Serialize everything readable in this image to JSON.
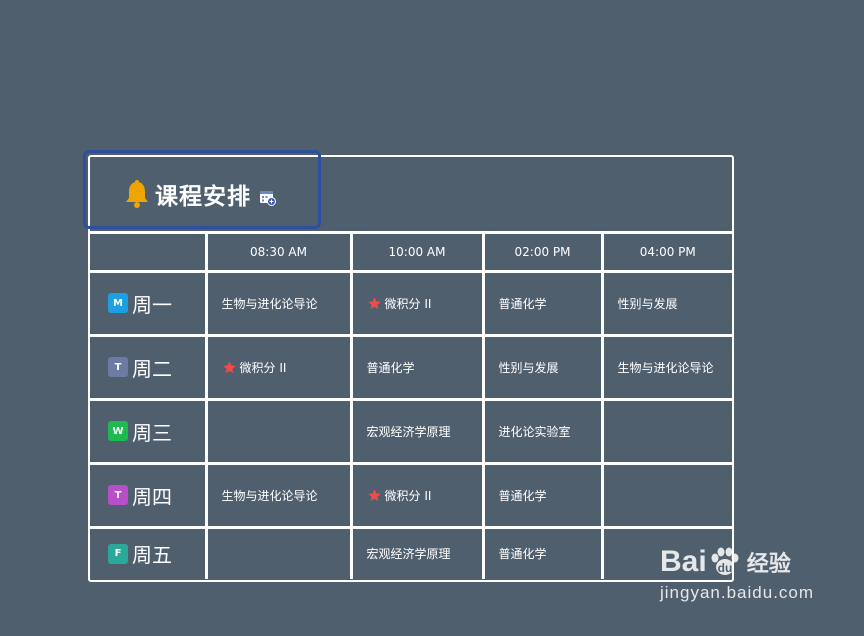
{
  "header": {
    "title": "课程安排"
  },
  "icons": {
    "title_icon": "bell-icon",
    "title_action_icon": "calendar-add-icon",
    "course_marker": "star-icon",
    "bell_color": "#f0a400",
    "star_color": "#ef4b4b"
  },
  "times": [
    "08:30 AM",
    "10:00 AM",
    "02:00 PM",
    "04:00 PM"
  ],
  "days": [
    {
      "badge": "M",
      "badge_color": "#1ba1e2",
      "label": "周一"
    },
    {
      "badge": "T",
      "badge_color": "#6d7aa3",
      "label": "周二"
    },
    {
      "badge": "W",
      "badge_color": "#1dbb4f",
      "label": "周三"
    },
    {
      "badge": "T",
      "badge_color": "#b84fc9",
      "label": "周四"
    },
    {
      "badge": "F",
      "badge_color": "#2aa89a",
      "label": "周五"
    }
  ],
  "schedule": [
    [
      {
        "name": "生物与进化论导论",
        "starred": false
      },
      {
        "name": "微积分 II",
        "starred": true
      },
      {
        "name": "普通化学",
        "starred": false
      },
      {
        "name": "性别与发展",
        "starred": false
      }
    ],
    [
      {
        "name": "微积分 II",
        "starred": true
      },
      {
        "name": "普通化学",
        "starred": false
      },
      {
        "name": "性别与发展",
        "starred": false
      },
      {
        "name": "生物与进化论导论",
        "starred": false
      }
    ],
    [
      {
        "name": "",
        "starred": false
      },
      {
        "name": "宏观经济学原理",
        "starred": false
      },
      {
        "name": "进化论实验室",
        "starred": false
      },
      {
        "name": "",
        "starred": false
      }
    ],
    [
      {
        "name": "生物与进化论导论",
        "starred": false
      },
      {
        "name": "微积分 II",
        "starred": true
      },
      {
        "name": "普通化学",
        "starred": false
      },
      {
        "name": "",
        "starred": false
      }
    ],
    [
      {
        "name": "",
        "starred": false
      },
      {
        "name": "宏观经济学原理",
        "starred": false
      },
      {
        "name": "普通化学",
        "starred": false
      },
      {
        "name": "",
        "starred": false
      }
    ]
  ],
  "watermark": {
    "brand_left": "Bai",
    "brand_right": "经验",
    "url": "jingyan.baidu.com"
  }
}
